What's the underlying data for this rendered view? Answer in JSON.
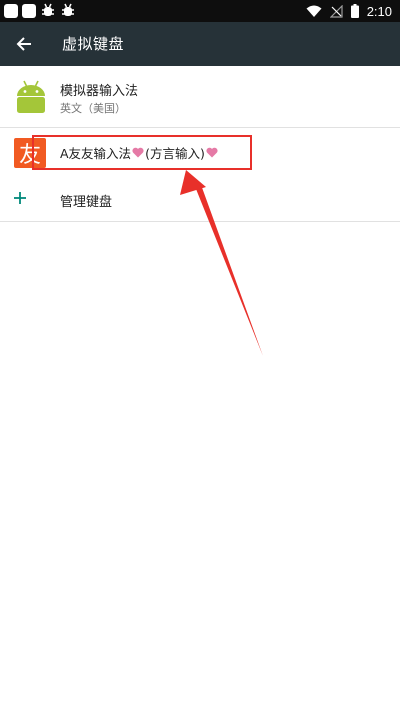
{
  "status_bar": {
    "time": "2:10",
    "icons": [
      "notification-square-icon",
      "notification-square-icon",
      "bug-icon",
      "bug-icon",
      "wifi-icon",
      "no-signal-icon",
      "battery-icon"
    ]
  },
  "app_bar": {
    "title": "虚拟键盘",
    "back_icon": "arrow-back-icon"
  },
  "keyboards": [
    {
      "title": "模拟器输入法",
      "subtitle": "英文（美国）",
      "icon": "android-icon"
    },
    {
      "title_parts": [
        "A友友输入法",
        "(方言输入)"
      ],
      "icon_text": "友",
      "icon": "youyou-app-icon",
      "decoration_icon": "heart-icon"
    }
  ],
  "manage": {
    "label": "管理键盘",
    "icon": "plus-icon"
  },
  "colors": {
    "status_bar": "#0e0e0e",
    "app_bar": "#263238",
    "accent": "#00897b",
    "highlight": "#e8302a",
    "heart": "#e57aa6",
    "youyou_icon": "#f15a22",
    "android_green": "#a4c639"
  }
}
